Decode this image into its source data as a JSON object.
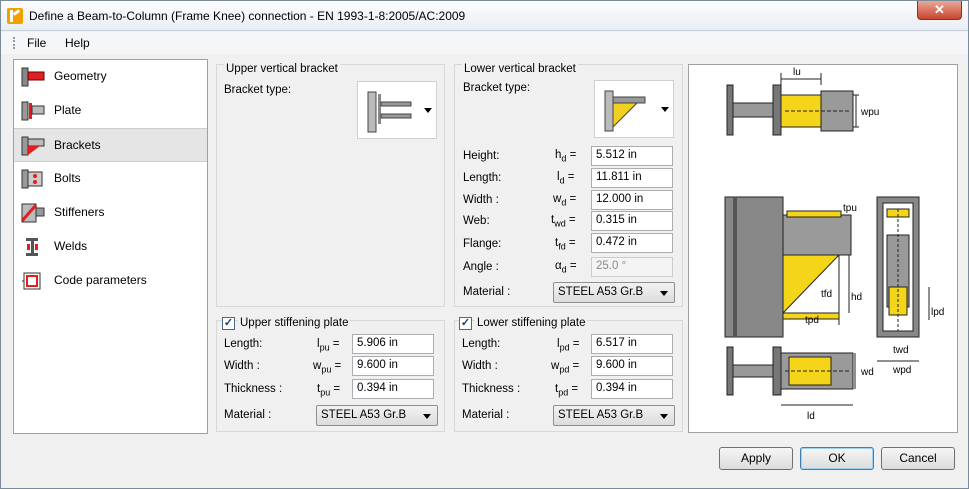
{
  "window": {
    "title": "Define a Beam-to-Column (Frame Knee) connection - EN 1993-1-8:2005/AC:2009",
    "close": "✕"
  },
  "menu": {
    "file": "File",
    "help": "Help"
  },
  "sidebar": {
    "items": [
      {
        "label": "Geometry",
        "icon": "geometry-icon"
      },
      {
        "label": "Plate",
        "icon": "plate-icon"
      },
      {
        "label": "Brackets",
        "icon": "brackets-icon"
      },
      {
        "label": "Bolts",
        "icon": "bolts-icon"
      },
      {
        "label": "Stiffeners",
        "icon": "stiffeners-icon"
      },
      {
        "label": "Welds",
        "icon": "welds-icon"
      },
      {
        "label": "Code parameters",
        "icon": "code-parameters-icon"
      }
    ],
    "selected": "Brackets"
  },
  "upper_bracket": {
    "title": "Upper vertical bracket",
    "type_label": "Bracket type:"
  },
  "lower_bracket": {
    "title": "Lower vertical bracket",
    "type_label": "Bracket type:",
    "rows": [
      {
        "label": "Height:",
        "sym": "h",
        "sub": "d",
        "value": "5.512 in"
      },
      {
        "label": "Length:",
        "sym": "l",
        "sub": "d",
        "value": "11.811 in"
      },
      {
        "label": "Width :",
        "sym": "w",
        "sub": "d",
        "value": "12.000 in"
      },
      {
        "label": "Web:",
        "sym": "t",
        "sub": "wd",
        "value": "0.315 in"
      },
      {
        "label": "Flange:",
        "sym": "t",
        "sub": "fd",
        "value": "0.472 in"
      },
      {
        "label": "Angle :",
        "sym": "α",
        "sub": "d",
        "value": "25.0 °"
      }
    ],
    "material_label": "Material :",
    "material": "STEEL A53 Gr.B"
  },
  "upper_stiff": {
    "title": "Upper stiffening plate",
    "checked": true,
    "rows": [
      {
        "label": "Length:",
        "sym": "l",
        "sub": "pu",
        "value": "5.906 in"
      },
      {
        "label": "Width :",
        "sym": "w",
        "sub": "pu",
        "value": "9.600 in"
      },
      {
        "label": "Thickness :",
        "sym": "t",
        "sub": "pu",
        "value": "0.394 in"
      }
    ],
    "material_label": "Material :",
    "material": "STEEL A53 Gr.B"
  },
  "lower_stiff": {
    "title": "Lower stiffening plate",
    "checked": true,
    "rows": [
      {
        "label": "Length:",
        "sym": "l",
        "sub": "pd",
        "value": "6.517 in"
      },
      {
        "label": "Width :",
        "sym": "w",
        "sub": "pd",
        "value": "9.600 in"
      },
      {
        "label": "Thickness :",
        "sym": "t",
        "sub": "pd",
        "value": "0.394 in"
      }
    ],
    "material_label": "Material :",
    "material": "STEEL A53 Gr.B"
  },
  "preview": {
    "labels": {
      "lu": "lu",
      "wpu": "wpu",
      "tpu": "tpu",
      "tfd": "tfd",
      "hd": "hd",
      "tpd": "tpd",
      "lpd": "lpd",
      "twd": "twd",
      "wpd": "wpd",
      "wd": "wd",
      "ld": "ld"
    }
  },
  "buttons": {
    "apply": "Apply",
    "ok": "OK",
    "cancel": "Cancel"
  }
}
